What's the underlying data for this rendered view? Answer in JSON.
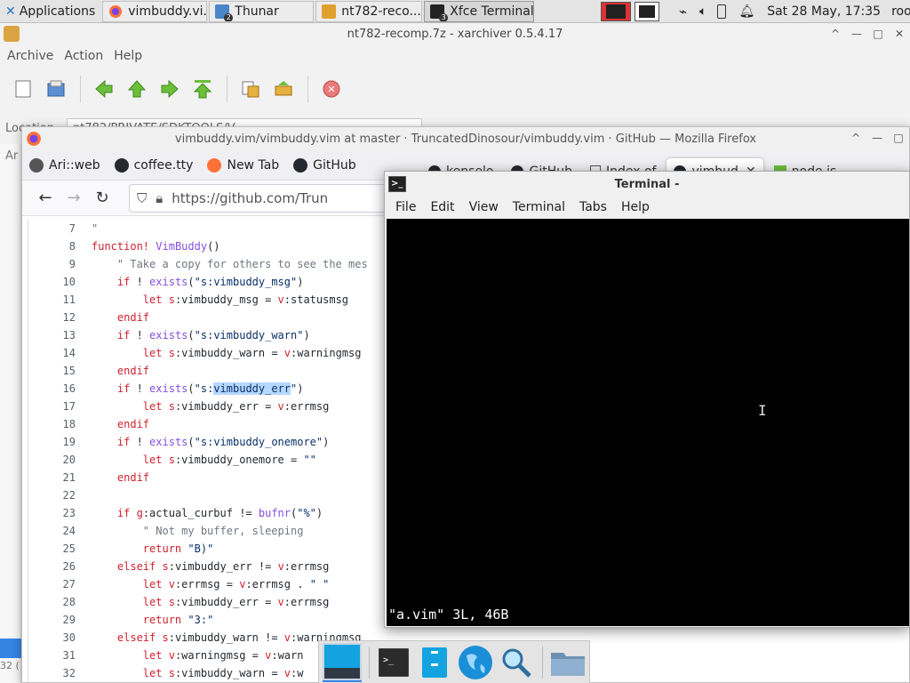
{
  "panel": {
    "applications": "Applications",
    "tasks": [
      {
        "label": "vimbuddy.vi...",
        "icon": "firefox-icon",
        "badge": ""
      },
      {
        "label": "Thunar",
        "icon": "folder-icon",
        "badge": "2"
      },
      {
        "label": "nt782-reco...",
        "icon": "archive-icon",
        "badge": ""
      },
      {
        "label": "Xfce Terminal",
        "icon": "terminal-icon",
        "badge": "3"
      }
    ],
    "clock": "Sat 28 May, 17:35",
    "user": "root"
  },
  "xarchiver": {
    "title": "nt782-recomp.7z - xarchiver 0.5.4.17",
    "menu": [
      "Archive",
      "Action",
      "Help"
    ],
    "location_label": "Location",
    "location_value": "nt782/PRIVATE/SDKTOOLS/V",
    "sidebar_label": "Ar",
    "sidebar_count": "32 ("
  },
  "firefox": {
    "title": "vimbuddy.vim/vimbuddy.vim at master · TruncatedDinosour/vimbuddy.vim · GitHub — Mozilla Firefox",
    "bookmarks": [
      {
        "label": "Ari::web",
        "color": "#333"
      },
      {
        "label": "coffee.tty",
        "color": "#24292f"
      },
      {
        "label": "New Tab",
        "color": "#ff7139"
      },
      {
        "label": "GitHub",
        "color": "#24292f"
      }
    ],
    "tabs": [
      {
        "label": "kenselo",
        "active": false
      },
      {
        "label": "GitHub",
        "active": false
      },
      {
        "label": "Index of",
        "active": false
      },
      {
        "label": "vimbud",
        "active": true
      },
      {
        "label": "node.js",
        "active": false
      }
    ],
    "url": "https://github.com/Trun",
    "code_lines": [
      {
        "n": "7",
        "html": "<span class=\"cmt\">\"</span>"
      },
      {
        "n": "8",
        "html": "<span class=\"kw\">function!</span> <span class=\"fn\">VimBuddy</span>()"
      },
      {
        "n": "9",
        "html": "    <span class=\"cmt\">\" Take a copy for others to see the mes</span>"
      },
      {
        "n": "10",
        "html": "    <span class=\"kw\">if</span> ! <span class=\"fn\">exists</span>(<span class=\"str\">\"s:vimbuddy_msg\"</span>)"
      },
      {
        "n": "11",
        "html": "        <span class=\"kw\">let</span> <span class=\"kw\">s</span>:vimbuddy_msg = <span class=\"kw\">v</span>:statusmsg"
      },
      {
        "n": "12",
        "html": "    <span class=\"kw\">endif</span>"
      },
      {
        "n": "13",
        "html": "    <span class=\"kw\">if</span> ! <span class=\"fn\">exists</span>(<span class=\"str\">\"s:vimbuddy_warn\"</span>)"
      },
      {
        "n": "14",
        "html": "        <span class=\"kw\">let</span> <span class=\"kw\">s</span>:vimbuddy_warn = <span class=\"kw\">v</span>:warningmsg"
      },
      {
        "n": "15",
        "html": "    <span class=\"kw\">endif</span>"
      },
      {
        "n": "16",
        "html": "    <span class=\"kw\">if</span> ! <span class=\"fn\">exists</span>(<span class=\"str\">\"s:<span class=\"hl\">vimbuddy_err</span>\"</span>)"
      },
      {
        "n": "17",
        "html": "        <span class=\"kw\">let</span> <span class=\"kw\">s</span>:vimbuddy_err = <span class=\"kw\">v</span>:errmsg"
      },
      {
        "n": "18",
        "html": "    <span class=\"kw\">endif</span>"
      },
      {
        "n": "19",
        "html": "    <span class=\"kw\">if</span> ! <span class=\"fn\">exists</span>(<span class=\"str\">\"s:vimbuddy_onemore\"</span>)"
      },
      {
        "n": "20",
        "html": "        <span class=\"kw\">let</span> <span class=\"kw\">s</span>:vimbuddy_onemore = <span class=\"str\">\"\"</span>"
      },
      {
        "n": "21",
        "html": "    <span class=\"kw\">endif</span>"
      },
      {
        "n": "22",
        "html": ""
      },
      {
        "n": "23",
        "html": "    <span class=\"kw\">if</span> <span class=\"kw\">g</span>:actual_curbuf != <span class=\"fn\">bufnr</span>(<span class=\"str\">\"%\"</span>)"
      },
      {
        "n": "24",
        "html": "        <span class=\"cmt\">\" Not my buffer, sleeping</span>"
      },
      {
        "n": "25",
        "html": "        <span class=\"kw\">return</span> <span class=\"str\">\"B)\"</span>"
      },
      {
        "n": "26",
        "html": "    <span class=\"kw\">elseif</span> <span class=\"kw\">s</span>:vimbuddy_err != <span class=\"kw\">v</span>:errmsg"
      },
      {
        "n": "27",
        "html": "        <span class=\"kw\">let</span> <span class=\"kw\">v</span>:errmsg = <span class=\"kw\">v</span>:errmsg . <span class=\"str\">\" \"</span>"
      },
      {
        "n": "28",
        "html": "        <span class=\"kw\">let</span> <span class=\"kw\">s</span>:vimbuddy_err = <span class=\"kw\">v</span>:errmsg"
      },
      {
        "n": "29",
        "html": "        <span class=\"kw\">return</span> <span class=\"str\">\"3:\"</span>"
      },
      {
        "n": "30",
        "html": "    <span class=\"kw\">elseif</span> <span class=\"kw\">s</span>:vimbuddy_warn != <span class=\"kw\">v</span>:warningmsg"
      },
      {
        "n": "31",
        "html": "        <span class=\"kw\">let</span> <span class=\"kw\">v</span>:warningmsg = <span class=\"kw\">v</span>:warn"
      },
      {
        "n": "32",
        "html": "        <span class=\"kw\">let</span> <span class=\"kw\">s</span>:vimbuddy_warn = <span class=\"kw\">v</span>:w"
      }
    ]
  },
  "terminal": {
    "title": "Terminal -",
    "menu": [
      "File",
      "Edit",
      "View",
      "Terminal",
      "Tabs",
      "Help"
    ],
    "status_line": "\"a.vim\" 3L, 46B"
  },
  "dock": {
    "items": [
      "show-desktop-icon",
      "terminal-icon",
      "file-manager-icon",
      "web-browser-icon",
      "app-finder-icon",
      "folder-icon"
    ]
  }
}
